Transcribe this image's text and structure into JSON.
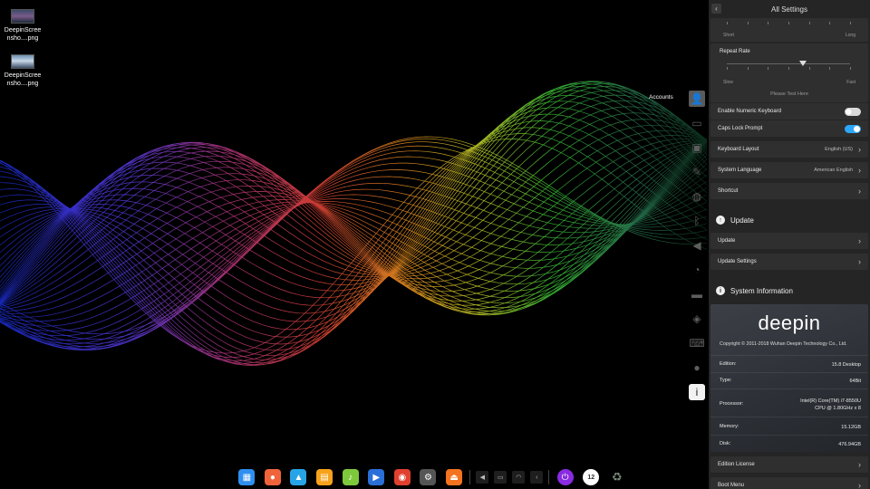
{
  "desktop": {
    "icons": [
      {
        "name": "DeepinScree\nnsho....png",
        "line1": "DeepinScree",
        "line2": "nsho....png"
      },
      {
        "name": "DeepinScree\nnsho....png",
        "line1": "DeepinScree",
        "line2": "nsho....png"
      }
    ]
  },
  "nav": {
    "accounts_tooltip": "Accounts",
    "icons": [
      "user-icon",
      "display-icon",
      "default-apps-icon",
      "personalization-icon",
      "network-icon",
      "bluetooth-icon",
      "sound-icon",
      "time-icon",
      "power-icon",
      "mouse-icon",
      "keyboard-icon",
      "update-icon",
      "info-icon"
    ]
  },
  "panel": {
    "title": "All Settings",
    "back_icon": "chevron-left-icon",
    "repeat_delay": {
      "left": "Short",
      "right": "Long"
    },
    "repeat_rate": {
      "label": "Repeat Rate",
      "left": "Slow",
      "right": "Fast",
      "value_fraction": 0.62
    },
    "test_placeholder": "Please Test Here",
    "numeric_keyboard": {
      "label": "Enable Numeric Keyboard",
      "on": false
    },
    "caps_lock": {
      "label": "Caps Lock Prompt",
      "on": true
    },
    "keyboard_layout": {
      "label": "Keyboard Layout",
      "value": "English (US)"
    },
    "system_language": {
      "label": "System Language",
      "value": "American English"
    },
    "shortcut": {
      "label": "Shortcut"
    },
    "update_section": {
      "title": "Update",
      "icon": "arrow-up-icon"
    },
    "update": {
      "label": "Update"
    },
    "update_settings": {
      "label": "Update Settings"
    },
    "sysinfo_section": {
      "title": "System Information",
      "icon": "info-icon"
    },
    "sysinfo": {
      "logo": "deepin",
      "copyright": "Copyright © 2011-2018 Wuhan Deepin Technology Co., Ltd.",
      "edition_key": "Edition:",
      "edition_val": "15.8 Desktop",
      "type_key": "Type:",
      "type_val": "64Bit",
      "processor_key": "Processor:",
      "processor_val1": "Intel(R) Core(TM) i7-8550U",
      "processor_val2": "CPU @ 1.80GHz x 8",
      "memory_key": "Memory:",
      "memory_val": "15.12GB",
      "disk_key": "Disk:",
      "disk_val": "476.94GB"
    },
    "edition_license": {
      "label": "Edition License"
    },
    "boot_menu": {
      "label": "Boot Menu"
    },
    "chevron": "›"
  },
  "dock": {
    "apps": [
      {
        "name": "launcher-icon",
        "color": "#2f8ff0",
        "glyph": "▦"
      },
      {
        "name": "screen-recorder-icon",
        "color": "#f0643c",
        "glyph": "●"
      },
      {
        "name": "app-store-icon",
        "color": "#27a4e8",
        "glyph": "▲"
      },
      {
        "name": "file-manager-icon",
        "color": "#f7a21b",
        "glyph": "▤"
      },
      {
        "name": "music-icon",
        "color": "#7ec83c",
        "glyph": "♪"
      },
      {
        "name": "video-icon",
        "color": "#2a6fd8",
        "glyph": "▶"
      },
      {
        "name": "chrome-icon",
        "color": "#e0402f",
        "glyph": "◉"
      },
      {
        "name": "settings-icon",
        "color": "#555555",
        "glyph": "⚙"
      },
      {
        "name": "deepin-store-icon",
        "color": "#f4731f",
        "glyph": "⏏"
      }
    ],
    "tray": [
      {
        "name": "volume-icon",
        "glyph": "◀"
      },
      {
        "name": "monitor-icon",
        "glyph": "▭"
      },
      {
        "name": "wifi-icon",
        "glyph": "◠"
      },
      {
        "name": "expand-icon",
        "glyph": "‹"
      }
    ],
    "power": {
      "name": "power-icon",
      "color": "#8a2be2",
      "glyph": "⏻"
    },
    "clock": {
      "name": "clock-icon",
      "text": "12"
    },
    "trash": {
      "name": "trash-icon",
      "glyph": "♻"
    }
  }
}
